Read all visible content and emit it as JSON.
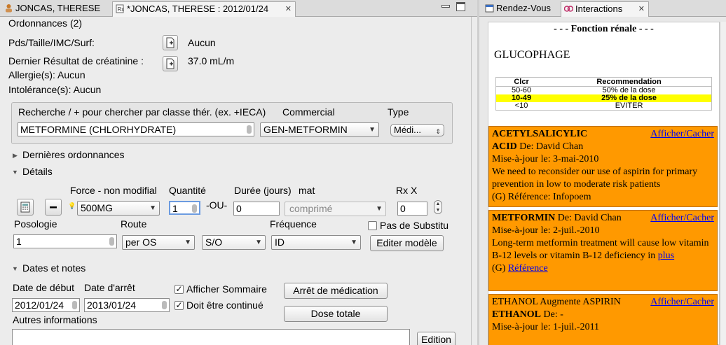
{
  "tabs_left": [
    {
      "label": "JONCAS, THERESE"
    },
    {
      "label": "*JONCAS, THERESE : 2012/01/24"
    }
  ],
  "tabs_right": [
    {
      "label": "Rendez-Vous"
    },
    {
      "label": "Interactions"
    }
  ],
  "form": {
    "section_title": "Ordonnances (2)",
    "pds_label": "Pds/Taille/IMC/Surf:",
    "pds_value": "Aucun",
    "creat_label": "Dernier Résultat de créatinine :",
    "creat_value": "37.0 mL/m",
    "allergies": "Allergie(s): Aucun",
    "intolerances": "Intolérance(s): Aucun",
    "search_label": "Recherche / + pour chercher par classe thér. (ex. +IECA)",
    "commercial_label": "Commercial",
    "type_label": "Type",
    "search_value": "METFORMINE (CHLORHYDRATE)",
    "commercial_value": "GEN-METFORMIN",
    "type_value": "Médi...",
    "last_orders": "Dernières ordonnances",
    "details": "Détails",
    "force_label": "Force - non modifial",
    "quantite_label": "Quantité",
    "duree_label": "Durée (jours)",
    "mat_label": "mat",
    "rx_label": "Rx X",
    "force_value": "500MG",
    "quantite_value": "1",
    "ou_label": "-OU-",
    "duree_value": "0",
    "forme_value": "comprimé",
    "rx_value": "0",
    "posologie_label": "Posologie",
    "route_label": "Route",
    "frequence_label": "Fréquence",
    "pas_substitution": "Pas de Substitu",
    "posologie_value": "1",
    "route_value": "per OS",
    "so_value": "S/O",
    "frequence_value": "ID",
    "editer_modele": "Editer modèle",
    "dates_notes": "Dates et notes",
    "date_debut_label": "Date de début",
    "date_arret_label": "Date d'arrêt",
    "date_debut": "2012/01/24",
    "date_arret": "2013/01/24",
    "afficher_sommaire": "Afficher Sommaire",
    "doit_continue": "Doit être continué",
    "arret_medication": "Arrêt de médication",
    "dose_totale": "Dose totale",
    "autres_info": "Autres informations",
    "edition": "Edition"
  },
  "interactions": {
    "title": "- - - Fonction rénale - - -",
    "drug": "GLUCOPHAGE",
    "table_headers": [
      "Clcr",
      "Recommendation"
    ],
    "table_rows": [
      {
        "clcr": "50-60",
        "rec": "50% de la dose"
      },
      {
        "clcr": "10-49",
        "rec": "25% de la dose"
      },
      {
        "clcr": "<10",
        "rec": "EVITER"
      }
    ],
    "toggle_label": "Afficher/Cacher",
    "card1": {
      "drug_a": "ACETYLSALICYLIC",
      "drug_b": "ACID",
      "author": " De: David Chan",
      "updated": "Mise-à-jour le: 3-mai-2010",
      "body": "We need to reconsider our use of aspirin for primary prevention in low to moderate risk patients",
      "reference": "(G) Référence: Infopoem"
    },
    "card2": {
      "drug": "METFORMIN",
      "author": " De: David Chan",
      "updated": "Mise-à-jour le: 2-juil.-2010",
      "body": "Long-term metformin treatment will cause low vitamin B-12 levels or vitamin B-12 deficiency in",
      "more": "plus",
      "ref_prefix": "(G) ",
      "ref_link": "Référence"
    },
    "card3": {
      "line1": "ETHANOL Augmente ASPIRIN",
      "drug_b": "ETHANOL",
      "author": " De: -",
      "updated": "Mise-à-jour le: 1-juil.-2011"
    }
  },
  "colors": {
    "card": "#ff9900",
    "highlight": "#ffff00",
    "link": "#0000ee"
  }
}
